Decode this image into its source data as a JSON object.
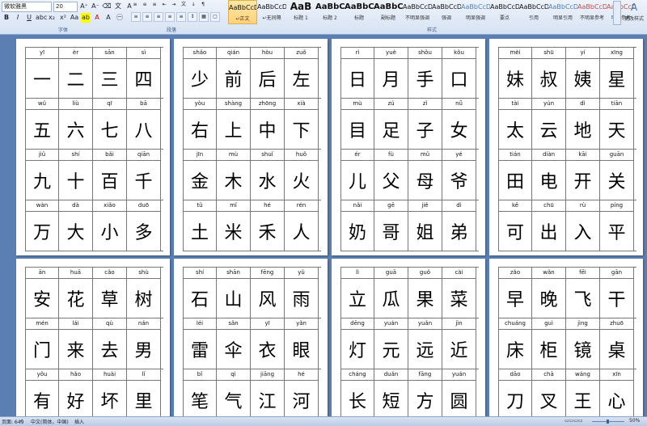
{
  "ribbon": {
    "font_name": "微软雅黑",
    "font_size": "20",
    "groups": {
      "font": "字体",
      "paragraph": "段落",
      "styles": "样式"
    },
    "styles": [
      {
        "sample": "AaBbCcD",
        "name": "↵正文",
        "kind": "normal",
        "selected": true
      },
      {
        "sample": "AaBbCcD",
        "name": "↵无间隔",
        "kind": "normal"
      },
      {
        "sample": "AaB",
        "name": "标题 1",
        "kind": "big"
      },
      {
        "sample": "AaBbC",
        "name": "标题 2",
        "kind": "mid"
      },
      {
        "sample": "AaBbC",
        "name": "标题",
        "kind": "mid"
      },
      {
        "sample": "AaBbC",
        "name": "副标题",
        "kind": "mid"
      },
      {
        "sample": "AaBbCcDc",
        "name": "不明显强调",
        "kind": "normal"
      },
      {
        "sample": "AaBbCcDc",
        "name": "强调",
        "kind": "normal"
      },
      {
        "sample": "AaBbCcDc",
        "name": "明显强调",
        "kind": "blue"
      },
      {
        "sample": "AaBbCcDc",
        "name": "要点",
        "kind": "normal"
      },
      {
        "sample": "AaBbCcDc",
        "name": "引用",
        "kind": "normal"
      },
      {
        "sample": "AaBbCcDc",
        "name": "明显引用",
        "kind": "blue"
      },
      {
        "sample": "AaBbCcDc",
        "name": "不明显参考",
        "kind": "red"
      },
      {
        "sample": "AaBbCcDc",
        "name": "明显参考",
        "kind": "red"
      }
    ],
    "change_styles": "更改样式"
  },
  "pages": [
    {
      "rows": [
        [
          [
            "yī",
            "一"
          ],
          [
            "èr",
            "二"
          ],
          [
            "sān",
            "三"
          ],
          [
            "sì",
            "四"
          ]
        ],
        [
          [
            "wǔ",
            "五"
          ],
          [
            "liù",
            "六"
          ],
          [
            "qī",
            "七"
          ],
          [
            "bā",
            "八"
          ]
        ],
        [
          [
            "jiǔ",
            "九"
          ],
          [
            "shí",
            "十"
          ],
          [
            "bǎi",
            "百"
          ],
          [
            "qiān",
            "千"
          ]
        ],
        [
          [
            "wàn",
            "万"
          ],
          [
            "dà",
            "大"
          ],
          [
            "xiǎo",
            "小"
          ],
          [
            "duō",
            "多"
          ]
        ]
      ]
    },
    {
      "rows": [
        [
          [
            "shǎo",
            "少"
          ],
          [
            "qián",
            "前"
          ],
          [
            "hòu",
            "后"
          ],
          [
            "zuǒ",
            "左"
          ]
        ],
        [
          [
            "yòu",
            "右"
          ],
          [
            "shàng",
            "上"
          ],
          [
            "zhōng",
            "中"
          ],
          [
            "xià",
            "下"
          ]
        ],
        [
          [
            "jīn",
            "金"
          ],
          [
            "mù",
            "木"
          ],
          [
            "shuǐ",
            "水"
          ],
          [
            "huǒ",
            "火"
          ]
        ],
        [
          [
            "tǔ",
            "土"
          ],
          [
            "mǐ",
            "米"
          ],
          [
            "hé",
            "禾"
          ],
          [
            "rén",
            "人"
          ]
        ]
      ]
    },
    {
      "rows": [
        [
          [
            "rì",
            "日"
          ],
          [
            "yuè",
            "月"
          ],
          [
            "shǒu",
            "手"
          ],
          [
            "kǒu",
            "口"
          ]
        ],
        [
          [
            "mù",
            "目"
          ],
          [
            "zú",
            "足"
          ],
          [
            "zǐ",
            "子"
          ],
          [
            "nǚ",
            "女"
          ]
        ],
        [
          [
            "ér",
            "儿"
          ],
          [
            "fù",
            "父"
          ],
          [
            "mǔ",
            "母"
          ],
          [
            "yé",
            "爷"
          ]
        ],
        [
          [
            "nǎi",
            "奶"
          ],
          [
            "gē",
            "哥"
          ],
          [
            "jiě",
            "姐"
          ],
          [
            "dì",
            "弟"
          ]
        ]
      ]
    },
    {
      "rows": [
        [
          [
            "mèi",
            "妹"
          ],
          [
            "shū",
            "叔"
          ],
          [
            "yí",
            "姨"
          ],
          [
            "xīng",
            "星"
          ]
        ],
        [
          [
            "tài",
            "太"
          ],
          [
            "yún",
            "云"
          ],
          [
            "dì",
            "地"
          ],
          [
            "tiān",
            "天"
          ]
        ],
        [
          [
            "tián",
            "田"
          ],
          [
            "diàn",
            "电"
          ],
          [
            "kāi",
            "开"
          ],
          [
            "guān",
            "关"
          ]
        ],
        [
          [
            "kě",
            "可"
          ],
          [
            "chū",
            "出"
          ],
          [
            "rù",
            "入"
          ],
          [
            "píng",
            "平"
          ]
        ]
      ]
    },
    {
      "rows": [
        [
          [
            "ān",
            "安"
          ],
          [
            "huā",
            "花"
          ],
          [
            "cǎo",
            "草"
          ],
          [
            "shù",
            "树"
          ]
        ],
        [
          [
            "mén",
            "门"
          ],
          [
            "lái",
            "来"
          ],
          [
            "qù",
            "去"
          ],
          [
            "nán",
            "男"
          ]
        ],
        [
          [
            "yǒu",
            "有"
          ],
          [
            "hǎo",
            "好"
          ],
          [
            "huài",
            "坏"
          ],
          [
            "lǐ",
            "里"
          ]
        ]
      ]
    },
    {
      "rows": [
        [
          [
            "shí",
            "石"
          ],
          [
            "shān",
            "山"
          ],
          [
            "fēng",
            "风"
          ],
          [
            "yǔ",
            "雨"
          ]
        ],
        [
          [
            "léi",
            "雷"
          ],
          [
            "sǎn",
            "伞"
          ],
          [
            "yī",
            "衣"
          ],
          [
            "yǎn",
            "眼"
          ]
        ],
        [
          [
            "bǐ",
            "笔"
          ],
          [
            "qì",
            "气"
          ],
          [
            "jiāng",
            "江"
          ],
          [
            "hé",
            "河"
          ]
        ]
      ]
    },
    {
      "rows": [
        [
          [
            "lì",
            "立"
          ],
          [
            "guā",
            "瓜"
          ],
          [
            "guǒ",
            "果"
          ],
          [
            "cài",
            "菜"
          ]
        ],
        [
          [
            "dēng",
            "灯"
          ],
          [
            "yuán",
            "元"
          ],
          [
            "yuǎn",
            "远"
          ],
          [
            "jìn",
            "近"
          ]
        ],
        [
          [
            "cháng",
            "长"
          ],
          [
            "duǎn",
            "短"
          ],
          [
            "fāng",
            "方"
          ],
          [
            "yuán",
            "圆"
          ]
        ]
      ]
    },
    {
      "rows": [
        [
          [
            "zǎo",
            "早"
          ],
          [
            "wǎn",
            "晚"
          ],
          [
            "fēi",
            "飞"
          ],
          [
            "gān",
            "干"
          ]
        ],
        [
          [
            "chuáng",
            "床"
          ],
          [
            "guì",
            "柜"
          ],
          [
            "jìng",
            "镜"
          ],
          [
            "zhuō",
            "桌"
          ]
        ],
        [
          [
            "dāo",
            "刀"
          ],
          [
            "chā",
            "叉"
          ],
          [
            "wáng",
            "王"
          ],
          [
            "xīn",
            "心"
          ]
        ]
      ]
    }
  ],
  "statusbar": {
    "page": "页面: 649",
    "language": "中文(简体，中国)",
    "mode": "插入",
    "zoom": "50%"
  }
}
